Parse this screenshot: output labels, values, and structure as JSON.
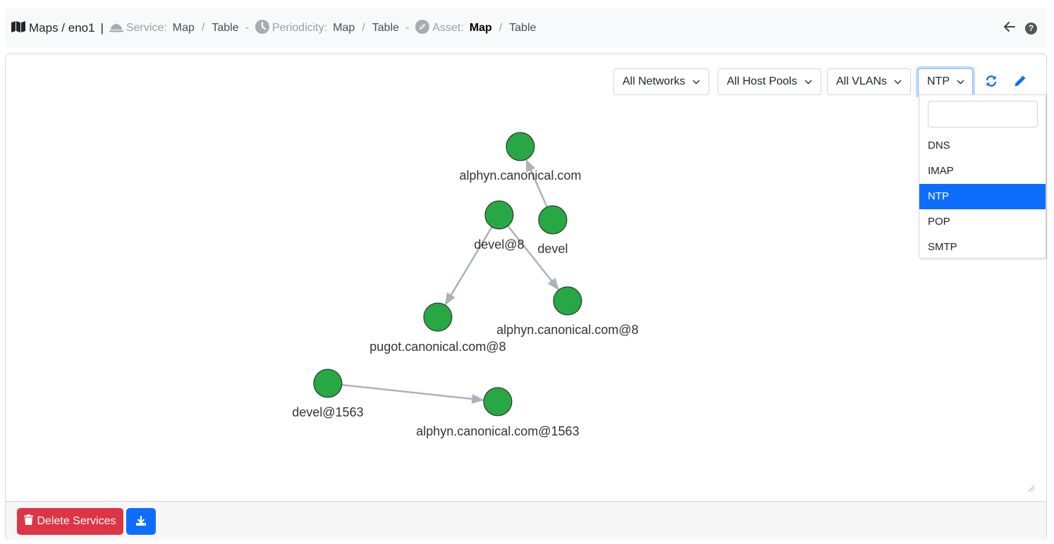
{
  "header": {
    "title": "Maps / eno1",
    "separator": "|",
    "groups": [
      {
        "label": "Service:",
        "icon": "bell-icon",
        "links": [
          {
            "text": "Map",
            "active": false
          },
          {
            "text": "Table",
            "active": false
          }
        ]
      },
      {
        "label": "Periodicity:",
        "icon": "clock-icon",
        "links": [
          {
            "text": "Map",
            "active": false
          },
          {
            "text": "Table",
            "active": false
          }
        ]
      },
      {
        "label": "Asset:",
        "icon": "compass-icon",
        "links": [
          {
            "text": "Map",
            "active": true
          },
          {
            "text": "Table",
            "active": false
          }
        ]
      }
    ],
    "link_separator": "/",
    "group_separator": "-",
    "right_icons": [
      "back-arrow-icon",
      "help-icon"
    ]
  },
  "filters": {
    "network": "All Networks",
    "host_pool": "All Host Pools",
    "vlan": "All VLANs",
    "protocol": "NTP"
  },
  "protocol_menu": {
    "search_value": "",
    "options": [
      "DNS",
      "IMAP",
      "NTP",
      "POP",
      "SMTP"
    ],
    "selected": "NTP"
  },
  "graph": {
    "node_color": "#28a745",
    "edge_color": "#aab3bb",
    "nodes": [
      {
        "id": "alphyn",
        "label": "alphyn.canonical.com"
      },
      {
        "id": "devel",
        "label": "devel"
      },
      {
        "id": "devel8",
        "label": "devel@8"
      },
      {
        "id": "pugot8",
        "label": "pugot.canonical.com@8"
      },
      {
        "id": "alphyn8",
        "label": "alphyn.canonical.com@8"
      },
      {
        "id": "devel1563",
        "label": "devel@1563"
      },
      {
        "id": "alphyn1563",
        "label": "alphyn.canonical.com@1563"
      }
    ],
    "edges": [
      {
        "from": "devel",
        "to": "alphyn"
      },
      {
        "from": "devel8",
        "to": "pugot8"
      },
      {
        "from": "devel8",
        "to": "alphyn8"
      },
      {
        "from": "devel1563",
        "to": "alphyn1563"
      }
    ]
  },
  "footer": {
    "delete_label": "Delete Services",
    "download_icon": "download-icon"
  },
  "colors": {
    "danger": "#dc3545",
    "primary": "#0d6efd",
    "node": "#28a745"
  }
}
